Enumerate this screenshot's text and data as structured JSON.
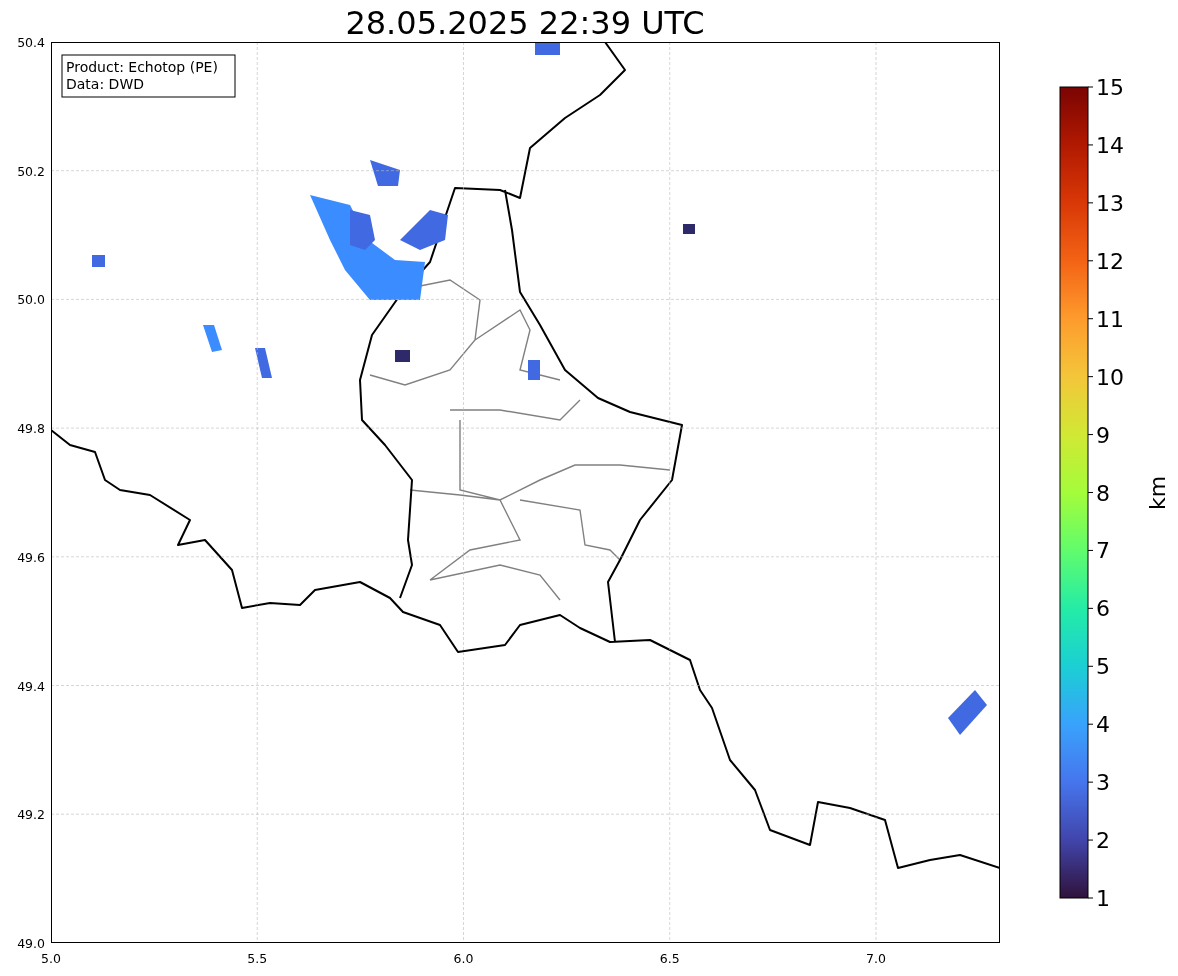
{
  "title": "28.05.2025 22:39 UTC",
  "info_box": {
    "lines": [
      "Product: Echotop (PE)",
      "Data: DWD"
    ]
  },
  "map": {
    "x_ticks": [
      "5.0",
      "5.5",
      "6.0",
      "6.5",
      "7.0"
    ],
    "y_ticks": [
      "50.4",
      "50.2",
      "50.0",
      "49.8",
      "49.6",
      "49.4",
      "49.2",
      "49.0"
    ]
  },
  "colorbar": {
    "label": "km",
    "ticks": [
      "15",
      "14",
      "13",
      "12",
      "11",
      "10",
      "9",
      "8",
      "7",
      "6",
      "5",
      "4",
      "3",
      "2",
      "1"
    ]
  }
}
